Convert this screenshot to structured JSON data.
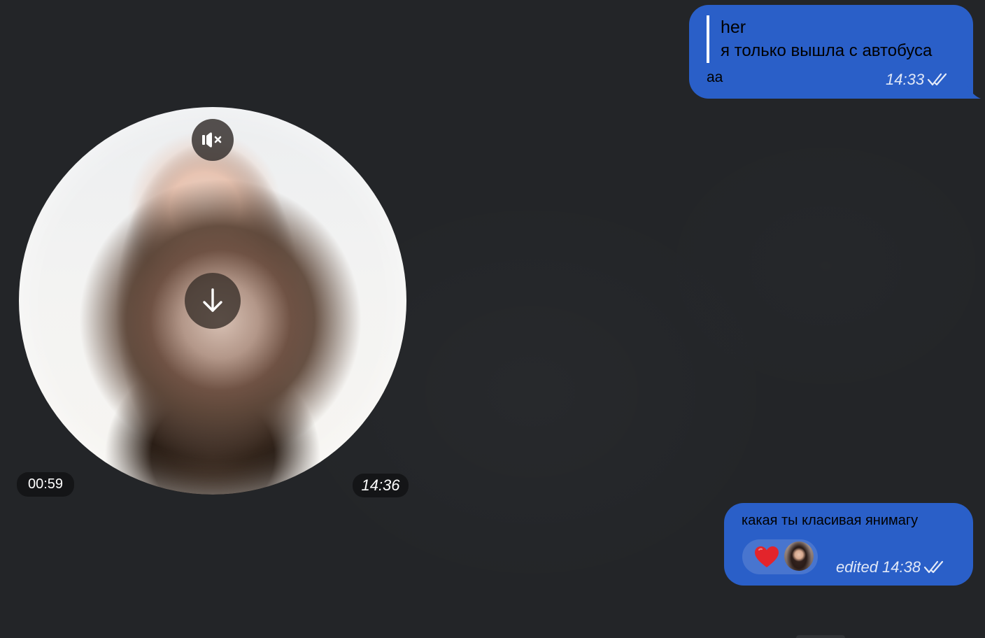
{
  "colors": {
    "background": "#232528",
    "bubble_outgoing": "#2a5fc8",
    "pill_background": "#121314",
    "text": "#ffffff",
    "heart": "#e3242b"
  },
  "messages": [
    {
      "type": "text",
      "direction": "outgoing",
      "reply": {
        "name": "her",
        "text": "я только вышла с автобуса"
      },
      "text": "аа",
      "time": "14:33",
      "status_icon": "double-check-icon"
    },
    {
      "type": "video-note",
      "direction": "incoming",
      "duration": "00:59",
      "time": "14:36",
      "mute_icon": "speaker-muted-icon",
      "download_icon": "download-arrow-icon"
    },
    {
      "type": "text",
      "direction": "outgoing",
      "text": "какая ты класивая янимагу",
      "reaction": {
        "emoji_icon": "red-heart-icon"
      },
      "meta": "edited 14:38",
      "status_icon": "double-check-icon"
    }
  ]
}
